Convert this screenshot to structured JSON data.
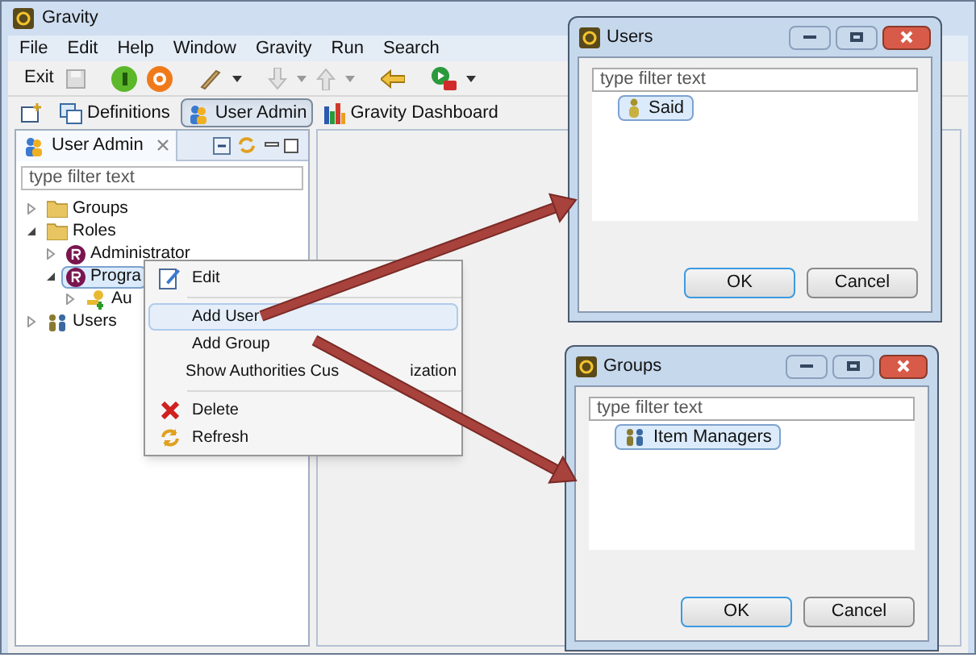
{
  "window": {
    "title": "Gravity"
  },
  "menu": [
    "File",
    "Edit",
    "Help",
    "Window",
    "Gravity",
    "Run",
    "Search"
  ],
  "toolbar": {
    "exit_label": "Exit"
  },
  "perspectives": [
    {
      "label": "Definitions",
      "selected": false,
      "kind": "definitions"
    },
    {
      "label": "User Admin",
      "selected": true,
      "kind": "users"
    },
    {
      "label": "Gravity Dashboard",
      "selected": false,
      "kind": "chart"
    }
  ],
  "view": {
    "title": "User Admin",
    "filter_placeholder": "type filter text",
    "tree": [
      {
        "label": "Groups",
        "kind": "folder",
        "expanded": false,
        "selected": false
      },
      {
        "label": "Roles",
        "kind": "folder",
        "expanded": true,
        "selected": false,
        "children": [
          {
            "label": "Administrator",
            "kind": "role",
            "expanded": false,
            "selected": false
          },
          {
            "label": "Progra",
            "kind": "role",
            "expanded": true,
            "selected": true,
            "children": [
              {
                "label": "Au",
                "kind": "key",
                "expanded": false,
                "selected": false
              }
            ]
          }
        ]
      },
      {
        "label": "Users",
        "kind": "people",
        "expanded": false,
        "selected": false
      }
    ]
  },
  "context_menu": [
    {
      "label": "Edit",
      "kind": "pencil",
      "selected": false
    },
    {
      "kind": "separator"
    },
    {
      "label": "Add User",
      "kind": "plain",
      "selected": true
    },
    {
      "label": "Add Group",
      "kind": "plain",
      "selected": false
    },
    {
      "label": "Show Authorities Cus",
      "label_after_arrow": "ization",
      "kind": "plain",
      "selected": false
    },
    {
      "kind": "separator"
    },
    {
      "label": "Delete",
      "kind": "cross",
      "selected": false
    },
    {
      "label": "Refresh",
      "kind": "arrows",
      "selected": false
    }
  ],
  "dialogs": [
    {
      "title": "Users",
      "filter_placeholder": "type filter text",
      "items": [
        {
          "label": "Said",
          "kind": "person",
          "selected": true
        }
      ],
      "buttons": [
        "OK",
        "Cancel"
      ]
    },
    {
      "title": "Groups",
      "filter_placeholder": "type filter text",
      "items": [
        {
          "label": "Item Managers",
          "kind": "people",
          "selected": true
        }
      ],
      "buttons": [
        "OK",
        "Cancel"
      ]
    }
  ]
}
